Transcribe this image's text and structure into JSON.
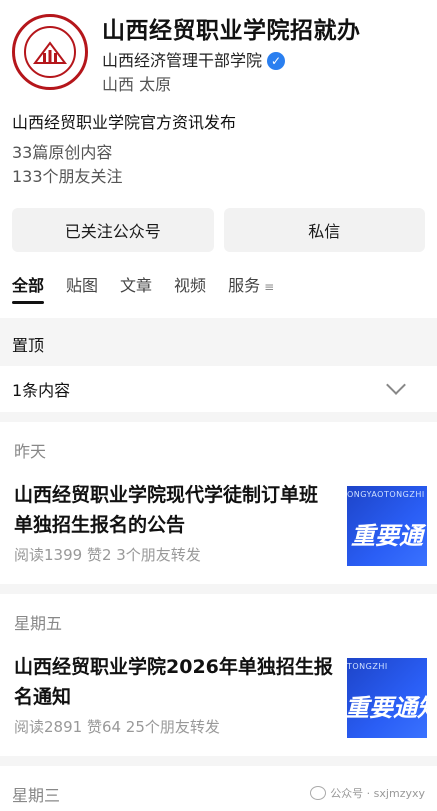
{
  "account": {
    "name": "山西经贸职业学院招就办",
    "org": "山西经济管理干部学院",
    "location": "山西 太原",
    "intro": "山西经贸职业学院官方资讯发布",
    "original_count": "33篇原创内容",
    "followers": "133个朋友关注"
  },
  "actions": {
    "followed": "已关注公众号",
    "message": "私信"
  },
  "tabs": [
    "全部",
    "贴图",
    "文章",
    "视频",
    "服务"
  ],
  "pinned": {
    "label": "置顶",
    "count": "1条内容"
  },
  "posts": [
    {
      "date": "昨天",
      "title": "山西经贸职业学院现代学徒制订单班单独招生报名的公告",
      "meta": "阅读1399  赞2  3个朋友转发",
      "thumb_top": "ONGYAOTONGZHI",
      "thumb_text": "重要通"
    },
    {
      "date": "星期五",
      "title": "山西经贸职业学院2026年单独招生报名通知",
      "meta": "阅读2891  赞64  25个朋友转发",
      "thumb_top": "TONGZHI",
      "thumb_text": "重要通知"
    }
  ],
  "next_date": "星期三",
  "watermark": "公众号 · sxjmzyxy",
  "colors": {
    "brand_red": "#b5161b",
    "verified_blue": "#2a7ff0",
    "thumb_blue": "#2a5ef5"
  }
}
